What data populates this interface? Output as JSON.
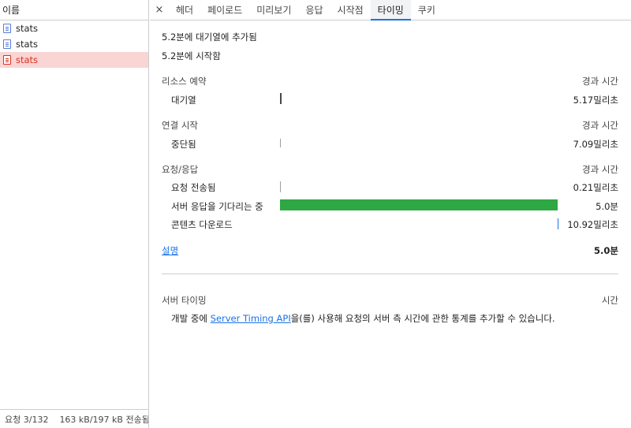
{
  "request_list": {
    "header": "이름",
    "items": [
      {
        "name": "stats",
        "selected": false
      },
      {
        "name": "stats",
        "selected": false
      },
      {
        "name": "stats",
        "selected": true
      }
    ],
    "status": {
      "requests": "요청 3/132",
      "transferred": "163 kB/197 kB 전송됨"
    }
  },
  "tabs": {
    "close_glyph": "×",
    "items": [
      "헤더",
      "페이로드",
      "미리보기",
      "응답",
      "시작점",
      "타이밍",
      "쿠키"
    ],
    "active": "타이밍"
  },
  "timing": {
    "queued_at": "5.2분에 대기열에 추가됨",
    "started_at": "5.2분에 시작함",
    "sections": {
      "resource": {
        "title": "리소스 예약",
        "col_head": "경과 시간",
        "rows": [
          {
            "label": "대기열",
            "value": "5.17밀리초",
            "color": "#474747"
          }
        ]
      },
      "connection": {
        "title": "연결 시작",
        "col_head": "경과 시간",
        "rows": [
          {
            "label": "중단됨",
            "value": "7.09밀리초",
            "color": "#9aa0a6"
          }
        ]
      },
      "request": {
        "title": "요청/응답",
        "col_head": "경과 시간",
        "rows": [
          {
            "label": "요청 전송됨",
            "value": "0.21밀리초",
            "color": "#9aa0a6"
          },
          {
            "label": "서버 응답을 기다리는 중",
            "value": "5.0분",
            "color": "#2da843"
          },
          {
            "label": "콘텐츠 다운로드",
            "value": "10.92밀리초",
            "color": "#1a73e8"
          }
        ]
      }
    },
    "explanation_link": "설명",
    "total": "5.0분"
  },
  "server_timing": {
    "title": "서버 타이밍",
    "col_head": "시간",
    "desc_before": "개발 중에 ",
    "desc_link": "Server Timing API",
    "desc_after": "을(를) 사용해 요청의 서버 측 시간에 관한 통계를 추가할 수 있습니다."
  }
}
